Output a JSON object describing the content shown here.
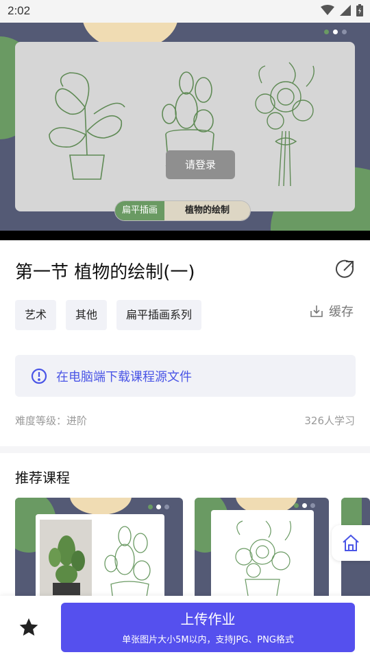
{
  "status": {
    "time": "2:02"
  },
  "hero": {
    "login_label": "请登录",
    "tag_left": "扁平插画",
    "tag_right": "植物的绘制"
  },
  "course": {
    "title": "第一节 植物的绘制(一)",
    "tags": [
      "艺术",
      "其他",
      "扁平插画系列"
    ],
    "cache_label": "缓存",
    "download_hint": "在电脑端下载课程源文件",
    "difficulty": "难度等级：进阶",
    "learners": "326人学习"
  },
  "recommend": {
    "title": "推荐课程"
  },
  "bottom": {
    "upload_label": "上传作业",
    "upload_sub": "单张图片大小5M以内，支持JPG、PNG格式"
  },
  "colors": {
    "accent": "#5550ee",
    "brand_green": "#6a9a63",
    "navy": "#545a75"
  },
  "icons": [
    "wifi-icon",
    "signal-icon",
    "battery-icon",
    "share-icon",
    "download-icon",
    "info-icon",
    "home-icon",
    "star-icon"
  ]
}
